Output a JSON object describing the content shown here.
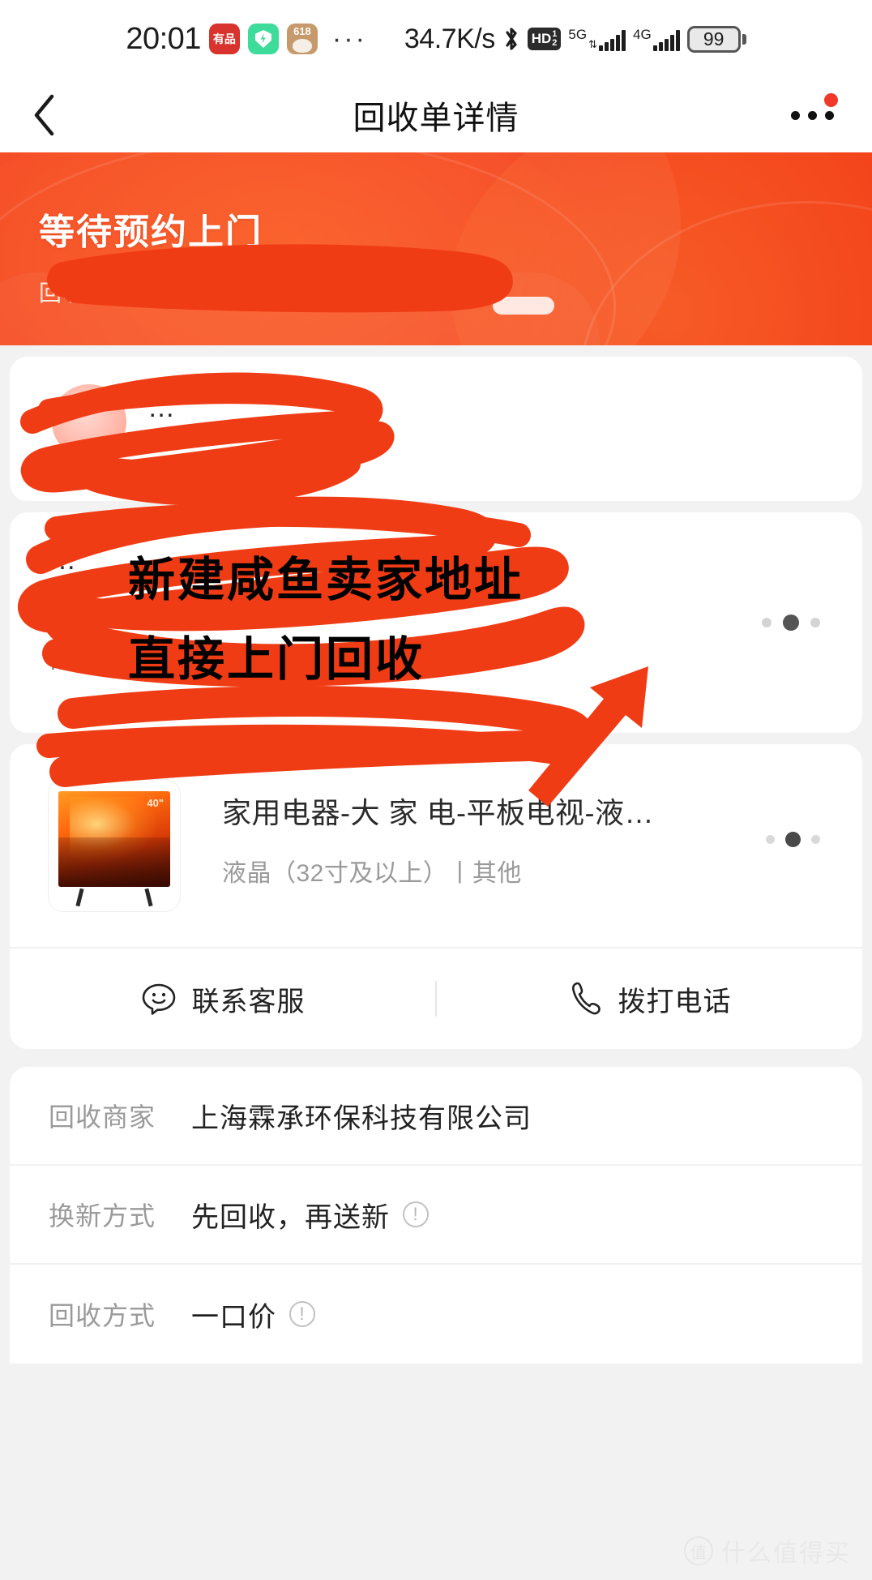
{
  "statusbar": {
    "time": "20:01",
    "app_icons": [
      "youpin-icon",
      "security-shield-icon",
      "618-promo-icon"
    ],
    "overflow": "···",
    "network_speed": "34.7K/s",
    "bluetooth": "bluetooth-icon",
    "hd_label": "HD",
    "hd_sim": {
      "top": "1",
      "bottom": "2"
    },
    "sim1_network": "5G",
    "sim2_network": "4G",
    "battery_level": "99"
  },
  "nav": {
    "back": "back-chevron",
    "title": "回收单详情",
    "more": "more-options",
    "has_badge": true
  },
  "hero": {
    "status_title": "等待预约上门",
    "sub_text": "回收…",
    "bg_color": "#f4401b"
  },
  "user_card": {
    "name": "…",
    "sub": "…"
  },
  "address_card": {
    "title": "…",
    "line1": "…",
    "line2": "…",
    "dots": [
      "",
      "active",
      ""
    ]
  },
  "item_card": {
    "thumb_label": "40\"",
    "title": "家用电器-大 家 电-平板电视-液…",
    "subtitle": "液晶（32寸及以上）丨其他",
    "dots": [
      "",
      "active",
      ""
    ]
  },
  "actions": {
    "customer_service": "联系客服",
    "call_phone": "拨打电话"
  },
  "info_rows": [
    {
      "label": "回收商家",
      "value": "上海霖承环保科技有限公司",
      "has_info_icon": false
    },
    {
      "label": "换新方式",
      "value": "先回收，再送新",
      "has_info_icon": true
    },
    {
      "label": "回收方式",
      "value": "一口价",
      "has_info_icon": true
    }
  ],
  "annotation": {
    "line1": "新建咸鱼卖家地址",
    "line2": "直接上门回收",
    "ink_color": "#f03c15"
  },
  "watermark": {
    "mark": "值",
    "text": "什么值得买"
  }
}
